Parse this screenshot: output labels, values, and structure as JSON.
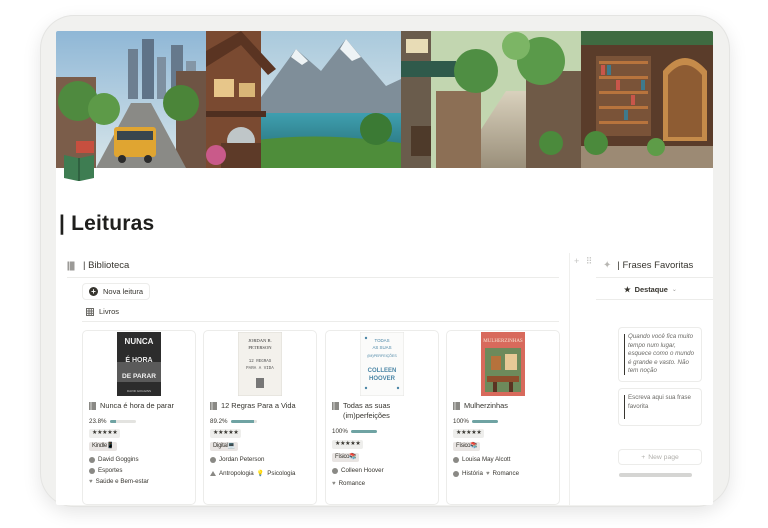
{
  "page": {
    "title": "| Leituras"
  },
  "biblioteca": {
    "heading": "| Biblioteca",
    "new_button": "Nova leitura",
    "view_label": "Livros",
    "books": [
      {
        "title": "Nunca é hora de parar",
        "progress_text": "23.8%",
        "progress": 0.238,
        "rating": "★★★★★",
        "format": "Kindle📱",
        "author": "David Goggins",
        "tags": [
          "Esportes",
          "Saúde e Bem-estar"
        ],
        "cover_lines": [
          "NUNCA",
          "É HORA",
          "DE PARAR",
          "DAVID GOGGINS"
        ]
      },
      {
        "title": "12 Regras Para a Vida",
        "progress_text": "89.2%",
        "progress": 0.892,
        "rating": "★★★★★",
        "format": "Digital💻",
        "author": "Jordan Peterson",
        "tags": [
          "Antropologia",
          "Psicologia"
        ],
        "cover_lines": [
          "JORDAN B.",
          "PETERSON",
          "12 REGRAS",
          "PARA A VIDA"
        ]
      },
      {
        "title": "Todas as suas (im)perfeições",
        "progress_text": "100%",
        "progress": 1.0,
        "rating": "★★★★★",
        "format": "Físico📚",
        "author": "Colleen Hoover",
        "tags": [
          "Romance"
        ],
        "cover_lines": [
          "TODAS",
          "AS SUAS",
          "(IM)PERFEIÇÕES",
          "COLLEEN",
          "HOOVER"
        ]
      },
      {
        "title": "Mulherzinhas",
        "progress_text": "100%",
        "progress": 1.0,
        "rating": "★★★★★",
        "format": "Físico📚",
        "author": "Louisa May Alcott",
        "tags": [
          "História",
          "Romance"
        ],
        "cover_lines": [
          "MULHERZINHAS"
        ]
      }
    ]
  },
  "frases": {
    "heading": "| Frases Favoritas",
    "filter": "Destaque",
    "quotes": [
      "Quando você fica muito tempo num lugar, esquece como o mundo é grande e vasto. Não tem noção",
      "Escreva aqui sua frase favorita"
    ],
    "new_page": "New page"
  },
  "colors": {
    "accent": "#6fa3a3",
    "text": "#37352f",
    "muted": "#9b9a97",
    "icon_green": "#3e7d52"
  },
  "icons": [
    "book-icon",
    "plus-circle-icon",
    "table-icon",
    "person-icon",
    "heart-icon",
    "star-icon",
    "sparkle-icon"
  ]
}
